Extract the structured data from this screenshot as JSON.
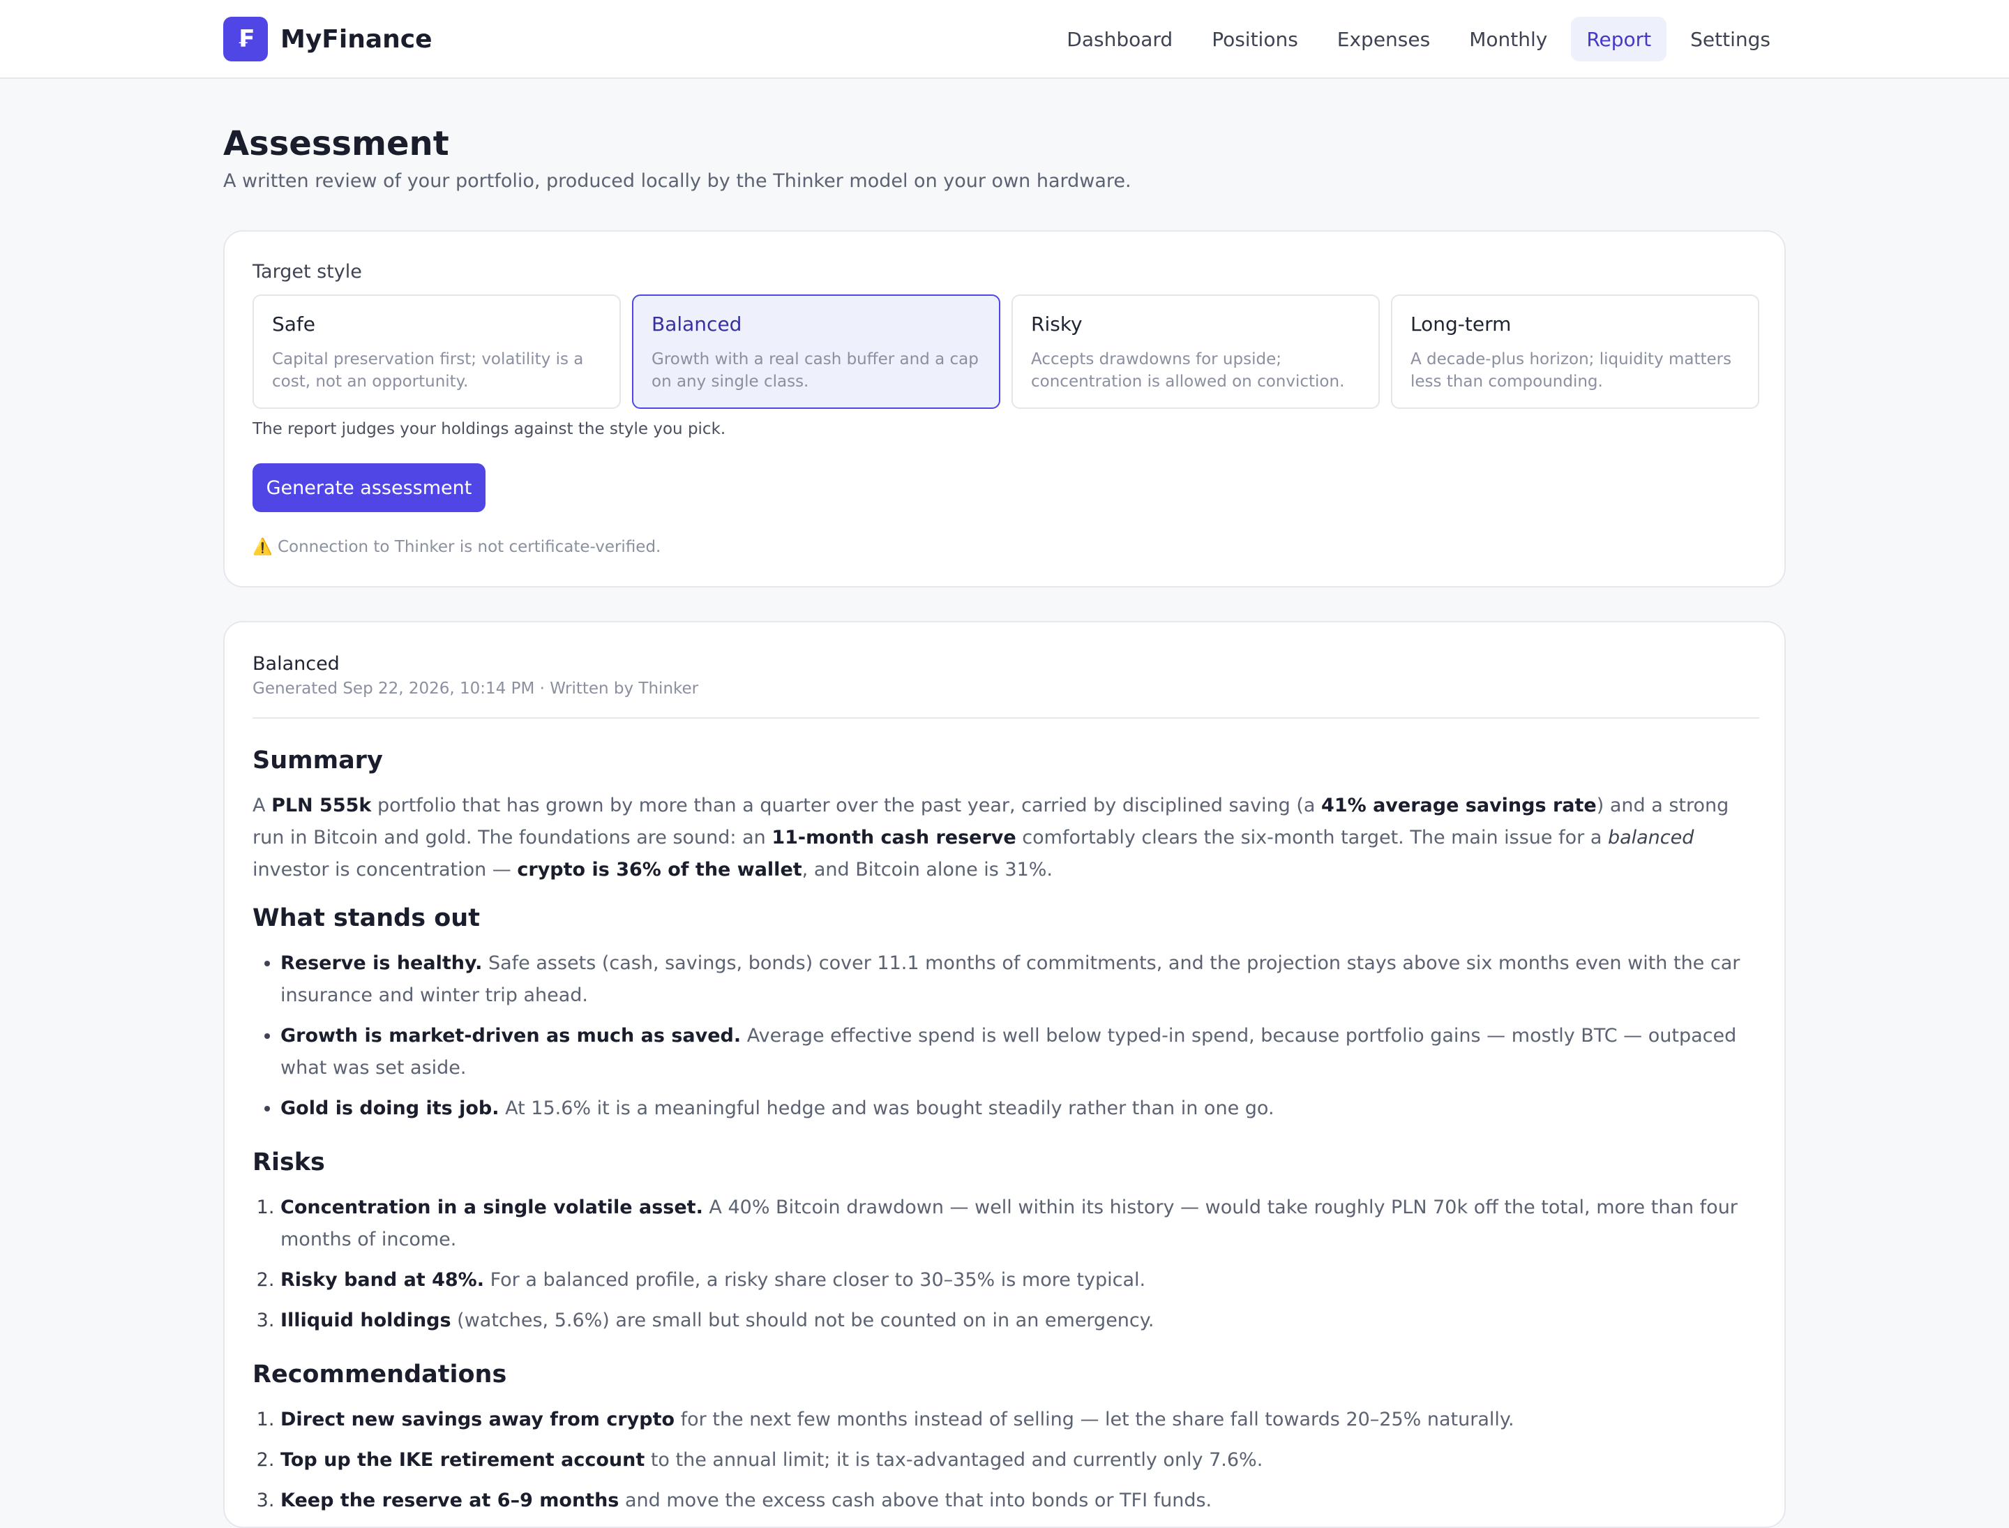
{
  "app": {
    "name": "MyFinance",
    "logo_glyph": "₣"
  },
  "nav": [
    {
      "label": "Dashboard",
      "active": false
    },
    {
      "label": "Positions",
      "active": false
    },
    {
      "label": "Expenses",
      "active": false
    },
    {
      "label": "Monthly",
      "active": false
    },
    {
      "label": "Report",
      "active": true
    },
    {
      "label": "Settings",
      "active": false
    }
  ],
  "page": {
    "title": "Assessment",
    "subtitle": "A written review of your portfolio, produced locally by the Thinker model on your own hardware."
  },
  "target": {
    "label": "Target style",
    "options": [
      {
        "name": "Safe",
        "desc": "Capital preservation first; volatility is a cost, not an opportunity.",
        "selected": false
      },
      {
        "name": "Balanced",
        "desc": "Growth with a real cash buffer and a cap on any single class.",
        "selected": true
      },
      {
        "name": "Risky",
        "desc": "Accepts drawdowns for upside; concentration is allowed on conviction.",
        "selected": false
      },
      {
        "name": "Long-term",
        "desc": "A decade-plus horizon; liquidity matters less than compounding.",
        "selected": false
      }
    ],
    "hint": "The report judges your holdings against the style you pick.",
    "button_label": "Generate assessment",
    "warning_icon": "⚠️",
    "warning_text": "Connection to Thinker is not certificate-verified."
  },
  "report": {
    "style": "Balanced",
    "meta": "Generated Sep 22, 2026, 10:14 PM · Written by Thinker",
    "summary": {
      "heading": "Summary",
      "s1": "A ",
      "b1": "PLN 555k",
      "s2": " portfolio that has grown by more than a quarter over the past year, carried by disciplined saving (a ",
      "b2": "41% average savings rate",
      "s3": ") and a strong run in Bitcoin and gold. The foundations are sound: an ",
      "b3": "11-month cash reserve",
      "s4": " comfortably clears the six-month target. The main issue for a ",
      "i1": "balanced",
      "s5": " investor is concentration — ",
      "b4": "crypto is 36% of the wallet",
      "s6": ", and Bitcoin alone is 31%."
    },
    "stands_out": {
      "heading": "What stands out",
      "items": [
        {
          "bold": "Reserve is healthy.",
          "text": " Safe assets (cash, savings, bonds) cover 11.1 months of commitments, and the projection stays above six months even with the car insurance and winter trip ahead."
        },
        {
          "bold": "Growth is market-driven as much as saved.",
          "text": " Average effective spend is well below typed-in spend, because portfolio gains — mostly BTC — outpaced what was set aside."
        },
        {
          "bold": "Gold is doing its job.",
          "text": " At 15.6% it is a meaningful hedge and was bought steadily rather than in one go."
        }
      ]
    },
    "risks": {
      "heading": "Risks",
      "items": [
        {
          "bold": "Concentration in a single volatile asset.",
          "text": " A 40% Bitcoin drawdown — well within its history — would take roughly PLN 70k off the total, more than four months of income."
        },
        {
          "bold": "Risky band at 48%.",
          "text": " For a balanced profile, a risky share closer to 30–35% is more typical."
        },
        {
          "bold": "Illiquid holdings",
          "text": " (watches, 5.6%) are small but should not be counted on in an emergency."
        }
      ]
    },
    "recommendations": {
      "heading": "Recommendations",
      "items": [
        {
          "bold": "Direct new savings away from crypto",
          "text": " for the next few months instead of selling — let the share fall towards 20–25% naturally."
        },
        {
          "bold": "Top up the IKE retirement account",
          "text": " to the annual limit; it is tax-advantaged and currently only 7.6%."
        },
        {
          "bold": "Keep the reserve at 6–9 months",
          "text": " and move the excess cash above that into bonds or TFI funds."
        }
      ]
    }
  }
}
